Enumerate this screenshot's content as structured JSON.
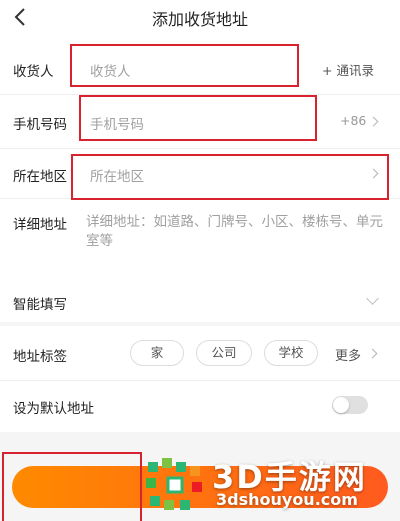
{
  "header": {
    "title": "添加收货地址",
    "back_icon": "back-arrow-icon"
  },
  "form": {
    "receiver": {
      "label": "收货人",
      "placeholder": "收货人",
      "action": "+ 通讯录"
    },
    "phone": {
      "label": "手机号码",
      "placeholder": "手机号码",
      "country_code": "+86"
    },
    "region": {
      "label": "所在地区",
      "placeholder": "所在地区"
    },
    "address": {
      "label": "详细地址",
      "placeholder": "详细地址：如道路、门牌号、小区、楼栋号、单元室等"
    }
  },
  "smart_fill": {
    "label": "智能填写"
  },
  "tags": {
    "label": "地址标签",
    "items": [
      "家",
      "公司",
      "学校"
    ],
    "more": "更多"
  },
  "default_address": {
    "label": "设为默认地址",
    "enabled": false
  },
  "watermark": {
    "brand": "3D手游网",
    "url": "3dshouyou.com"
  },
  "colors": {
    "highlight": "#d8222d",
    "button_start": "#ff8a00",
    "button_end": "#ff5a1f"
  }
}
